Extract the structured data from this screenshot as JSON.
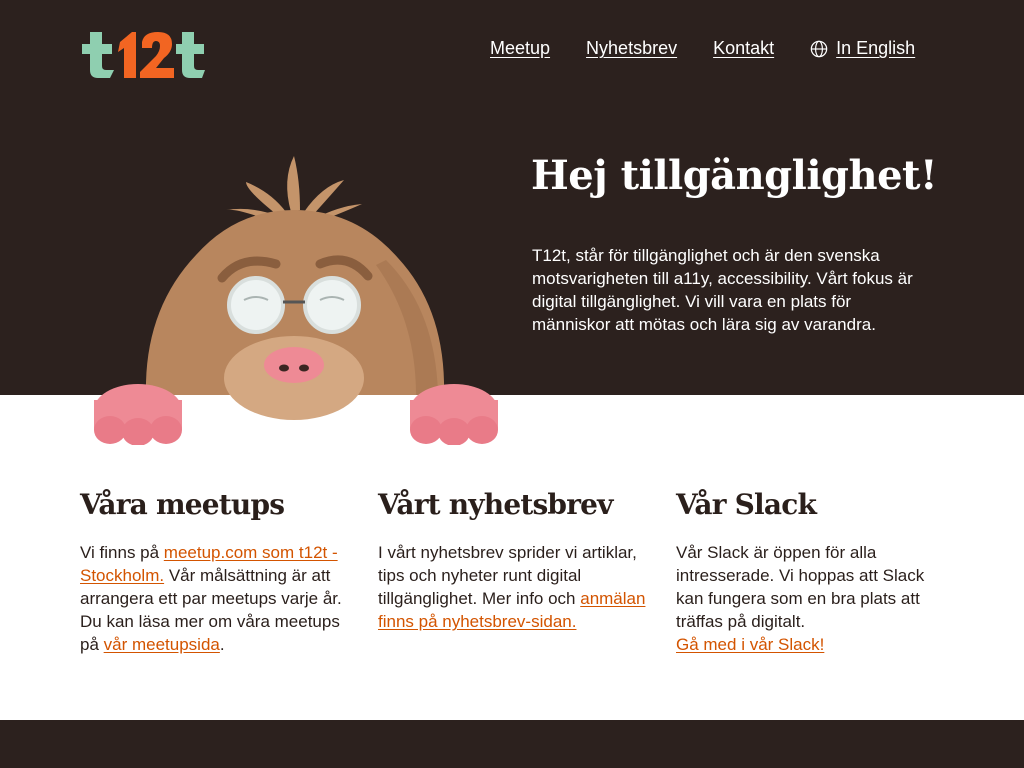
{
  "logo": {
    "text": "t12t"
  },
  "nav": {
    "meetup": "Meetup",
    "newsletter": "Nyhetsbrev",
    "contact": "Kontakt",
    "english": "In English"
  },
  "hero": {
    "title": "Hej tillgänglighet!",
    "text": "T12t, står för tillgänglighet och är den svenska motsvarigheten till a11y, accessibility. Vårt fokus är digital tillgänglighet. Vi vill vara en plats för människor att mötas och lära sig av varandra."
  },
  "columns": {
    "meetups": {
      "title": "Våra meetups",
      "text_before": "Vi finns på ",
      "link1": "meetup.com som t12t - Stockholm.",
      "text_middle": " Vår målsättning är att arrangera ett par meetups varje år. Du kan läsa mer om våra meetups på ",
      "link2": "vår meetupsida",
      "text_after": "."
    },
    "newsletter": {
      "title": "Vårt nyhetsbrev",
      "text_before": "I vårt nyhetsbrev sprider vi artiklar, tips och nyheter runt digital tillgänglighet. Mer info och ",
      "link": "anmälan finns på nyhetsbrev-sidan."
    },
    "slack": {
      "title": "Vår Slack",
      "text_before": "Vår Slack är öppen för alla intresserade. Vi hoppas att Slack kan fungera som en bra plats att träffas på digitalt.",
      "link": "Gå med i vår Slack!"
    }
  },
  "colors": {
    "dark_background": "#2c211e",
    "accent_orange": "#d35400",
    "logo_green": "#8fcfb0",
    "logo_orange": "#f26522",
    "mole_body": "#b8865e",
    "mole_paw": "#ee8a95"
  },
  "icons": {
    "language": "globe-icon",
    "mascot": "mole-mascot"
  }
}
